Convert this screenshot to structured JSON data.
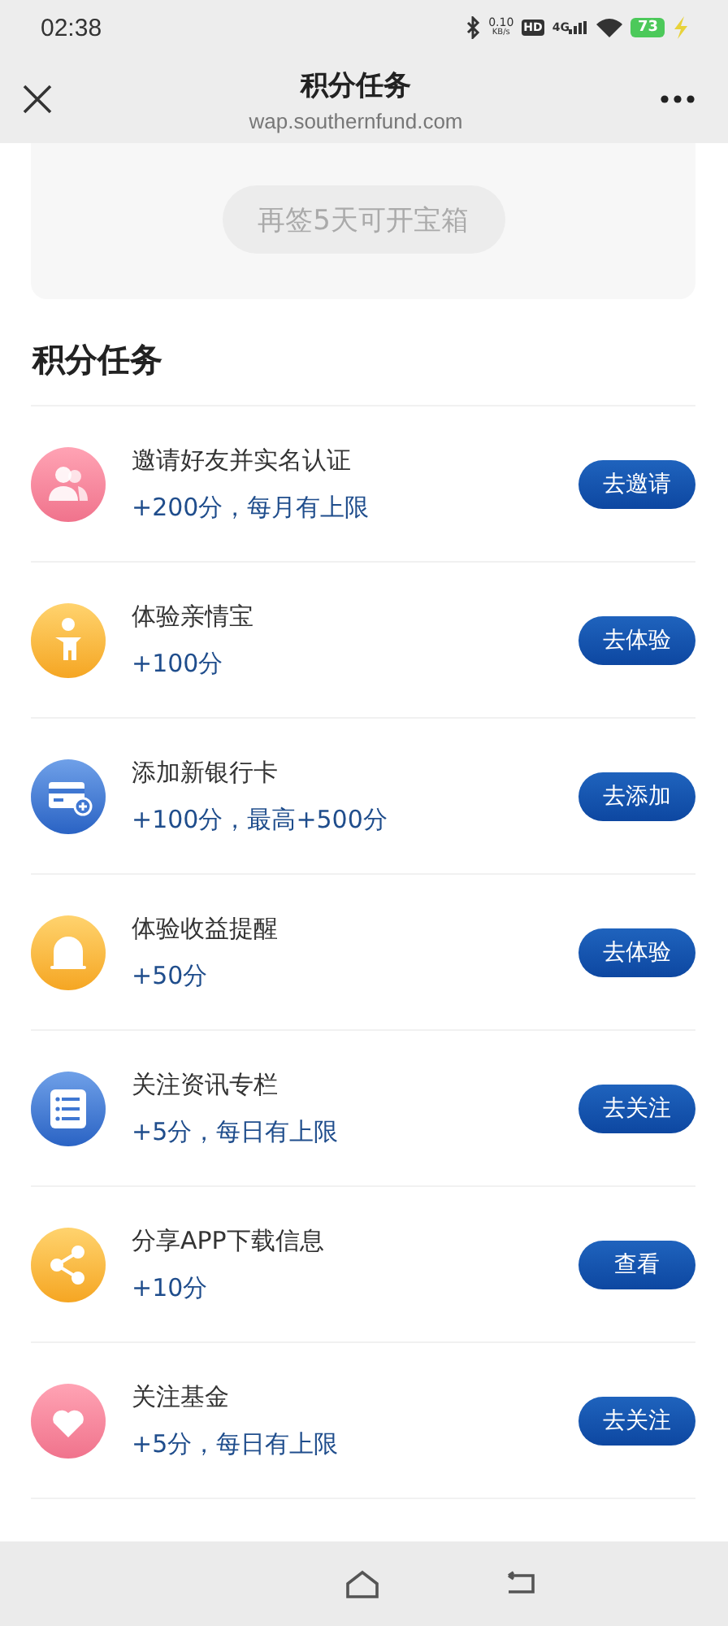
{
  "status_bar": {
    "time": "02:38",
    "net_speed": "0.10",
    "net_unit": "KB/s",
    "hd": "HD",
    "network": "4G",
    "battery": "73"
  },
  "header": {
    "title": "积分任务",
    "subtitle": "wap.southernfund.com"
  },
  "checkin_card": {
    "button": "再签5天可开宝箱"
  },
  "section_title": "积分任务",
  "tasks": [
    {
      "title": "邀请好友并实名认证",
      "points": "+200分，每月有上限",
      "action": "去邀请"
    },
    {
      "title": "体验亲情宝",
      "points": "+100分",
      "action": "去体验"
    },
    {
      "title": "添加新银行卡",
      "points": "+100分，最高+500分",
      "action": "去添加"
    },
    {
      "title": "体验收益提醒",
      "points": "+50分",
      "action": "去体验"
    },
    {
      "title": "关注资讯专栏",
      "points": "+5分，每日有上限",
      "action": "去关注"
    },
    {
      "title": "分享APP下载信息",
      "points": "+10分",
      "action": "查看"
    },
    {
      "title": "关注基金",
      "points": "+5分，每日有上限",
      "action": "去关注"
    }
  ]
}
